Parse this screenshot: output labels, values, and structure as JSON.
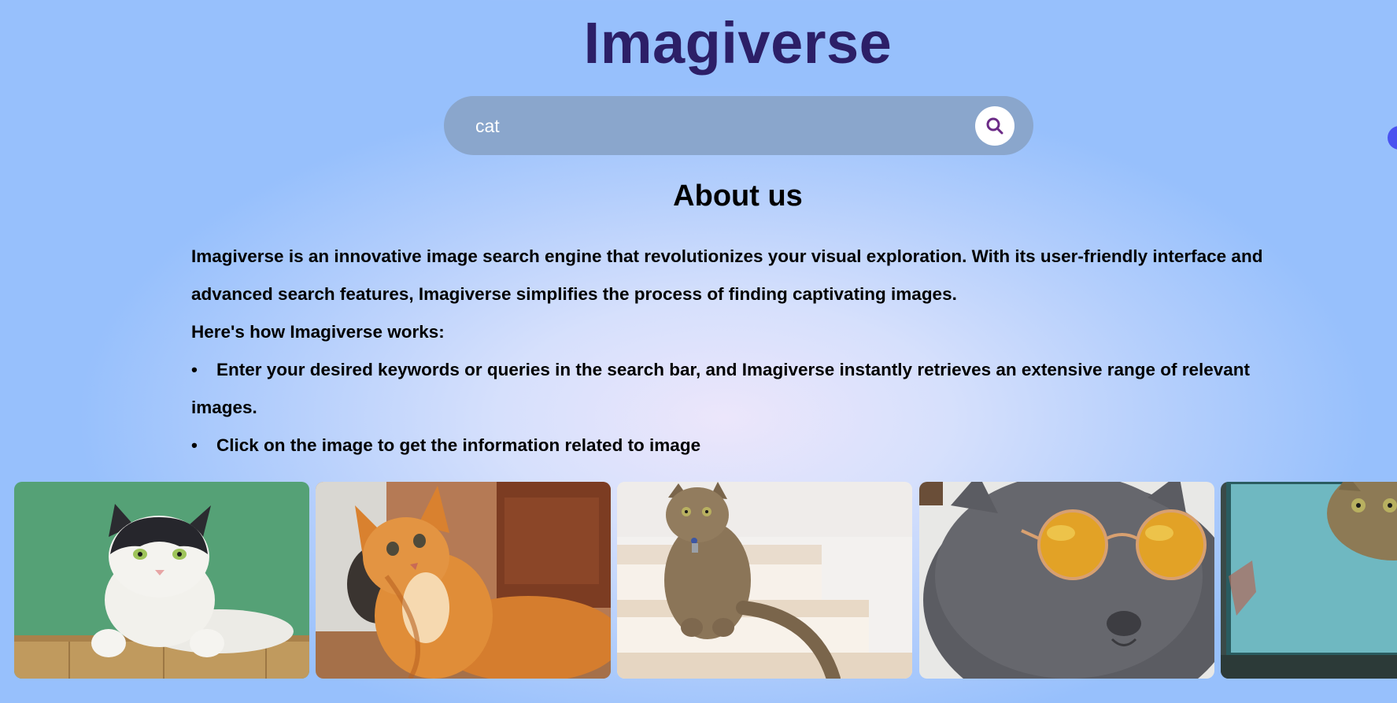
{
  "header": {
    "brand": "Imagiverse"
  },
  "search": {
    "value": "cat",
    "button_icon": "search-icon",
    "icon_color": "#6b2a86"
  },
  "about": {
    "title": "About us",
    "intro": "Imagiverse is an innovative image search engine that revolutionizes your visual exploration. With its user-friendly interface and advanced search features, Imagiverse simplifies the process of finding captivating images.",
    "how_heading": "Here's how Imagiverse works:",
    "steps": [
      "Enter your desired keywords or queries in the search bar, and Imagiverse instantly retrieves an extensive range of relevant images.",
      "Click on the image to get the information related to image"
    ]
  },
  "results": [
    {
      "subject": "black-and-white-cat-on-green-background"
    },
    {
      "subject": "orange-cat-lying-down"
    },
    {
      "subject": "tabby-cat-on-stairs"
    },
    {
      "subject": "gray-cat-with-sunglasses"
    },
    {
      "subject": "tabby-cat-peeking-through-window"
    }
  ],
  "colors": {
    "brand": "#2c1f67",
    "search_bar": "#8aa6cc",
    "accent_dot": "#4a53f0"
  }
}
